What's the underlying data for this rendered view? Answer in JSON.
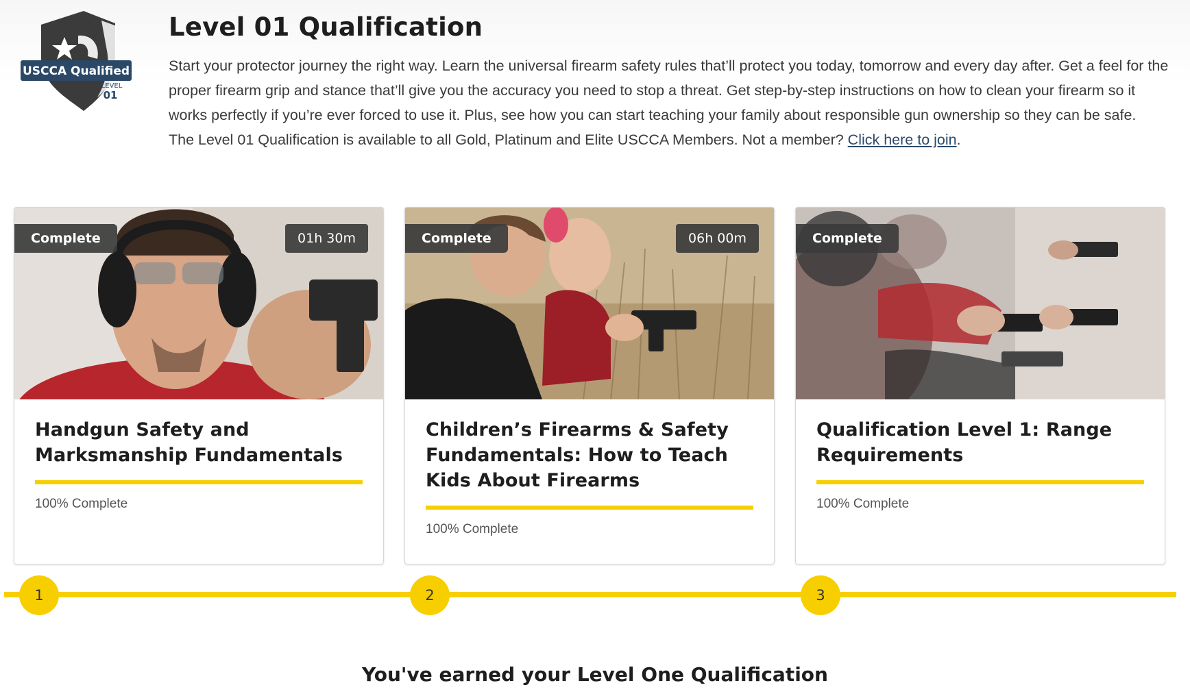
{
  "header": {
    "badge": {
      "label": "USCCA Qualified",
      "level_word": "LEVEL",
      "level_num": "01"
    },
    "title": "Level 01 Qualification",
    "description": "Start your protector journey the right way. Learn the universal firearm safety rules that’ll protect you today, tomorrow and every day after. Get a feel for the proper firearm grip and stance that’ll give you the accuracy you need to stop a threat. Get step-by-step instructions on how to clean your firearm so it works perfectly if you’re ever forced to use it. Plus, see how you can start teaching your family about responsible gun ownership so they can be safe.",
    "availability": "The Level 01 Qualification is available to all Gold, Platinum and Elite USCCA Members. Not a member?",
    "join_link": "Click here to join",
    "period": "."
  },
  "courses": [
    {
      "status": "Complete",
      "duration": "01h 30m",
      "title": "Handgun Safety and Marksmanship Fundamentals",
      "progress_text": "100% Complete",
      "progress": 1.0
    },
    {
      "status": "Complete",
      "duration": "06h 00m",
      "title": "Children’s Firearms & Safety Fundamentals: How to Teach Kids About Firearms",
      "progress_text": "100% Complete",
      "progress": 1.0
    },
    {
      "status": "Complete",
      "duration": "",
      "title": "Qualification Level 1: Range Requirements",
      "progress_text": "100% Complete",
      "progress": 1.0
    }
  ],
  "timeline": {
    "steps": [
      "1",
      "2",
      "3"
    ]
  },
  "footer": {
    "earned": "You've earned your Level One Qualification"
  },
  "colors": {
    "accent": "#f7cf00",
    "pill_bg": "#3c3c3c",
    "link": "#2c4a6b"
  }
}
